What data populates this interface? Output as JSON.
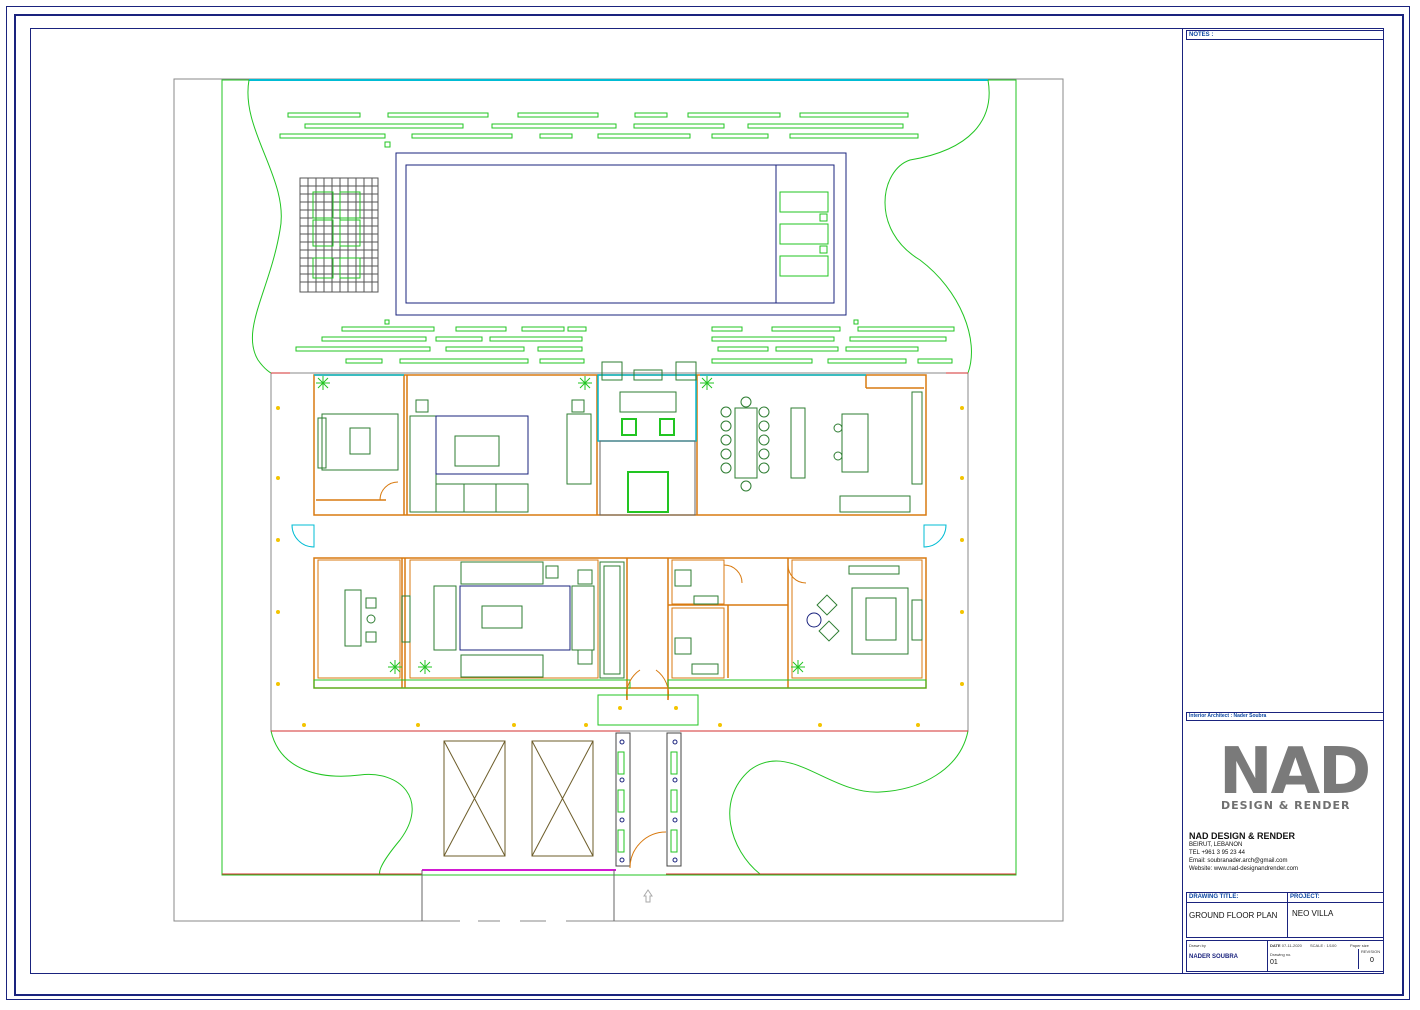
{
  "notes_label": "NOTES :",
  "architect_line": "Interior Architect : Nader Soubra",
  "company": {
    "logo_text": "NAD",
    "logo_sub": "DESIGN & RENDER",
    "name": "NAD DESIGN & RENDER",
    "city": "BEIRUT, LEBANON",
    "tel": "TEL +961 3 95 23 44",
    "email": "Email: soubranader.arch@gmail.com",
    "website": "Website: www.nad-designandrender.com"
  },
  "drawing_title_label": "DRAWING TITLE:",
  "drawing_title": "GROUND FLOOR PLAN",
  "project_label": "PROJECT:",
  "project": "NEO VILLA",
  "drawn_by_label": "Drawn by",
  "drawn_by": "NADER SOUBRA",
  "date_label": "DATE",
  "date": "07-11-2020",
  "scale_label": "SCALE",
  "scale": "1/100",
  "paper_label": "Paper size",
  "drawing_no_label": "Drawing no.",
  "drawing_no": "01",
  "revision_label": "REVISION",
  "revision": "0",
  "colors": {
    "frame": "#1a237e",
    "landscape": "#22c522",
    "walls": "#d87a10",
    "furniture": "#2e7d32",
    "water": "#00bcd4",
    "gate": "#d21ad2",
    "parking": "#6d5d2a"
  }
}
